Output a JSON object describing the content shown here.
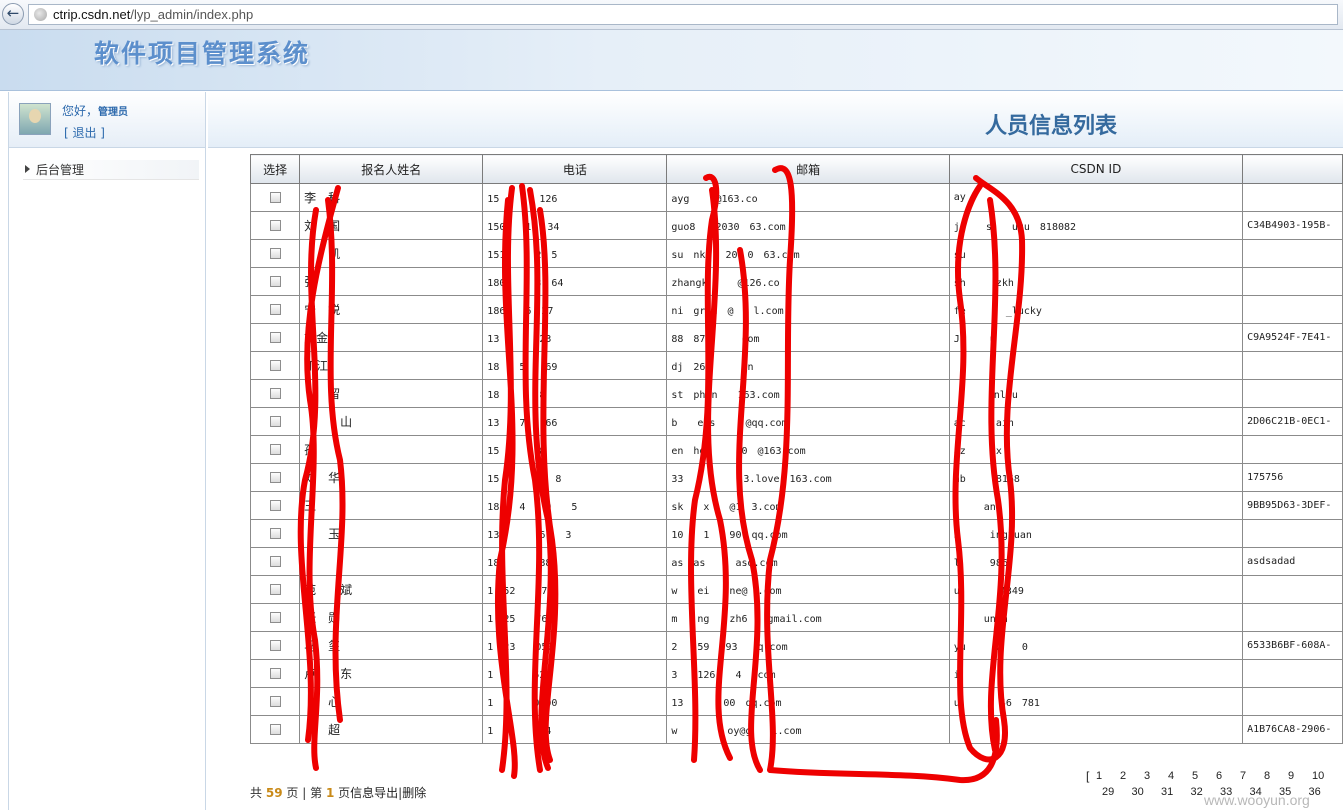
{
  "browser": {
    "url_host": "ctrip.csdn.net",
    "url_path": "/lyp_admin/index.php"
  },
  "app": {
    "title": "软件项目管理系统"
  },
  "sidebar": {
    "greeting": "您好，",
    "user_name": "管理员",
    "logout": "[ 退出 ]",
    "nav_items": [
      {
        "label": "后台管理"
      }
    ]
  },
  "page": {
    "title": "人员信息列表"
  },
  "table": {
    "headers": [
      "选择",
      "报名人姓名",
      "电话",
      "邮箱",
      "CSDN ID",
      ""
    ],
    "rows": [
      {
        "name": "李　科",
        "phone": "15　　　　126",
        "email": "ayg　　k@163.co",
        "csdn": "ay",
        "extra": ""
      },
      {
        "name": "刘　国",
        "phone": "150　　19　34",
        "email": "guo8　　2030　63.com",
        "csdn": "ja　　s　　ugu　818082",
        "extra": "C34B4903-195B-"
      },
      {
        "name": "　　凯",
        "phone": "151　　　2　5",
        "email": "su　nk　　20　0　63.com",
        "csdn": "su　　　　",
        "extra": ""
      },
      {
        "name": "张　　　",
        "phone": "180　　　3　64",
        "email": "zhangk　　　@126.co",
        "csdn": "sh　　　zkh",
        "extra": ""
      },
      {
        "name": "宁　锐",
        "phone": "186　　6　27",
        "email": "ni　grin　@　　l.com",
        "csdn": "fe　　　　_lucky",
        "extra": ""
      },
      {
        "name": "刘金　",
        "phone": "13　　　　23",
        "email": "88　877　　　com",
        "csdn": "J　　　u",
        "extra": "C9A9524F-7E41-"
      },
      {
        "name": "丁江　",
        "phone": "18　　5　　69",
        "email": "dj　266　　　cn",
        "csdn": "",
        "extra": ""
      },
      {
        "name": "　　留　",
        "phone": "18　　　　8",
        "email": "st　phen　　163.com",
        "csdn": "　　　　nluu",
        "extra": ""
      },
      {
        "name": "　　　山",
        "phone": "13　　7　　66",
        "email": "b　　ees　　　@qq.com",
        "csdn": "ac　　　ain",
        "extra": "2D06C21B-0EC1-"
      },
      {
        "name": "孙　　",
        "phone": "15　　　　8",
        "email": "en　hou　　　0　@163.com",
        "csdn": "az　　　x",
        "extra": ""
      },
      {
        "name": "刘　华",
        "phone": "15　　　　7　8",
        "email": "33　　　　　　3.love　163.com",
        "csdn": "ab　　　8168",
        "extra": "175756"
      },
      {
        "name": "王　　",
        "phone": "18　　4　　9　　5",
        "email": "sk　　x　　@1　3.com",
        "csdn": "　　　an",
        "extra": "9BB95D63-3DEF-"
      },
      {
        "name": "　　玉",
        "phone": "13　　　　6　　3",
        "email": "10　　1　　90　qq.com",
        "csdn": "h　　　ingxuan",
        "extra": ""
      },
      {
        "name": "　　",
        "phone": "18　　　　88",
        "email": "as　as　　　asd.com",
        "csdn": "l　　　986",
        "extra": "asdsadad"
      },
      {
        "name": "范　　斌",
        "phone": "1　52　　770",
        "email": "w　　ei　　ne@　.com",
        "csdn": "u　　　　4349",
        "extra": ""
      },
      {
        "name": "张　勋",
        "phone": "1　25　　768",
        "email": "m　　ng　　zh6　　gmail.com",
        "csdn": "　　　unzh",
        "extra": ""
      },
      {
        "name": "马　玺",
        "phone": "1　23　　050",
        "email": "2　　59　593　　q.com",
        "csdn": "yu　　　2　　0",
        "extra": "6533B6BF-608A-"
      },
      {
        "name": "卢　　东",
        "phone": "1　　　　522",
        "email": "3　　126　　4　.com",
        "csdn": "i　　　　",
        "extra": ""
      },
      {
        "name": "　　心",
        "phone": "1　　　　0000",
        "email": "13　　　　00　qq.com",
        "csdn": "u　　　　46　781",
        "extra": ""
      },
      {
        "name": "　　超",
        "phone": "1　　　　074",
        "email": "w　　　　　oy@g　　l.com",
        "csdn": "　　　　C",
        "extra": "A1B76CA8-2906-"
      }
    ]
  },
  "footer": {
    "total_prefix": "共",
    "total_pages": "59",
    "total_suffix": "页",
    "sep": "|",
    "page_prefix": "第",
    "current_page": "1",
    "page_suffix": "页",
    "export_link": "信息导出",
    "delete_link": "删除"
  },
  "pagination": {
    "open_bracket": "[",
    "row1": [
      "1",
      "2",
      "3",
      "4",
      "5",
      "6",
      "7",
      "8",
      "9",
      "10"
    ],
    "row2": [
      "29",
      "30",
      "31",
      "32",
      "33",
      "34",
      "35",
      "36"
    ]
  },
  "watermark": "www.wooyun.org",
  "colors": {
    "scribble": "#ee0000",
    "title_blue": "#5c8fcc",
    "page_title": "#356a9e",
    "link_blue": "#2d6aad",
    "highlight": "#c98a18"
  }
}
